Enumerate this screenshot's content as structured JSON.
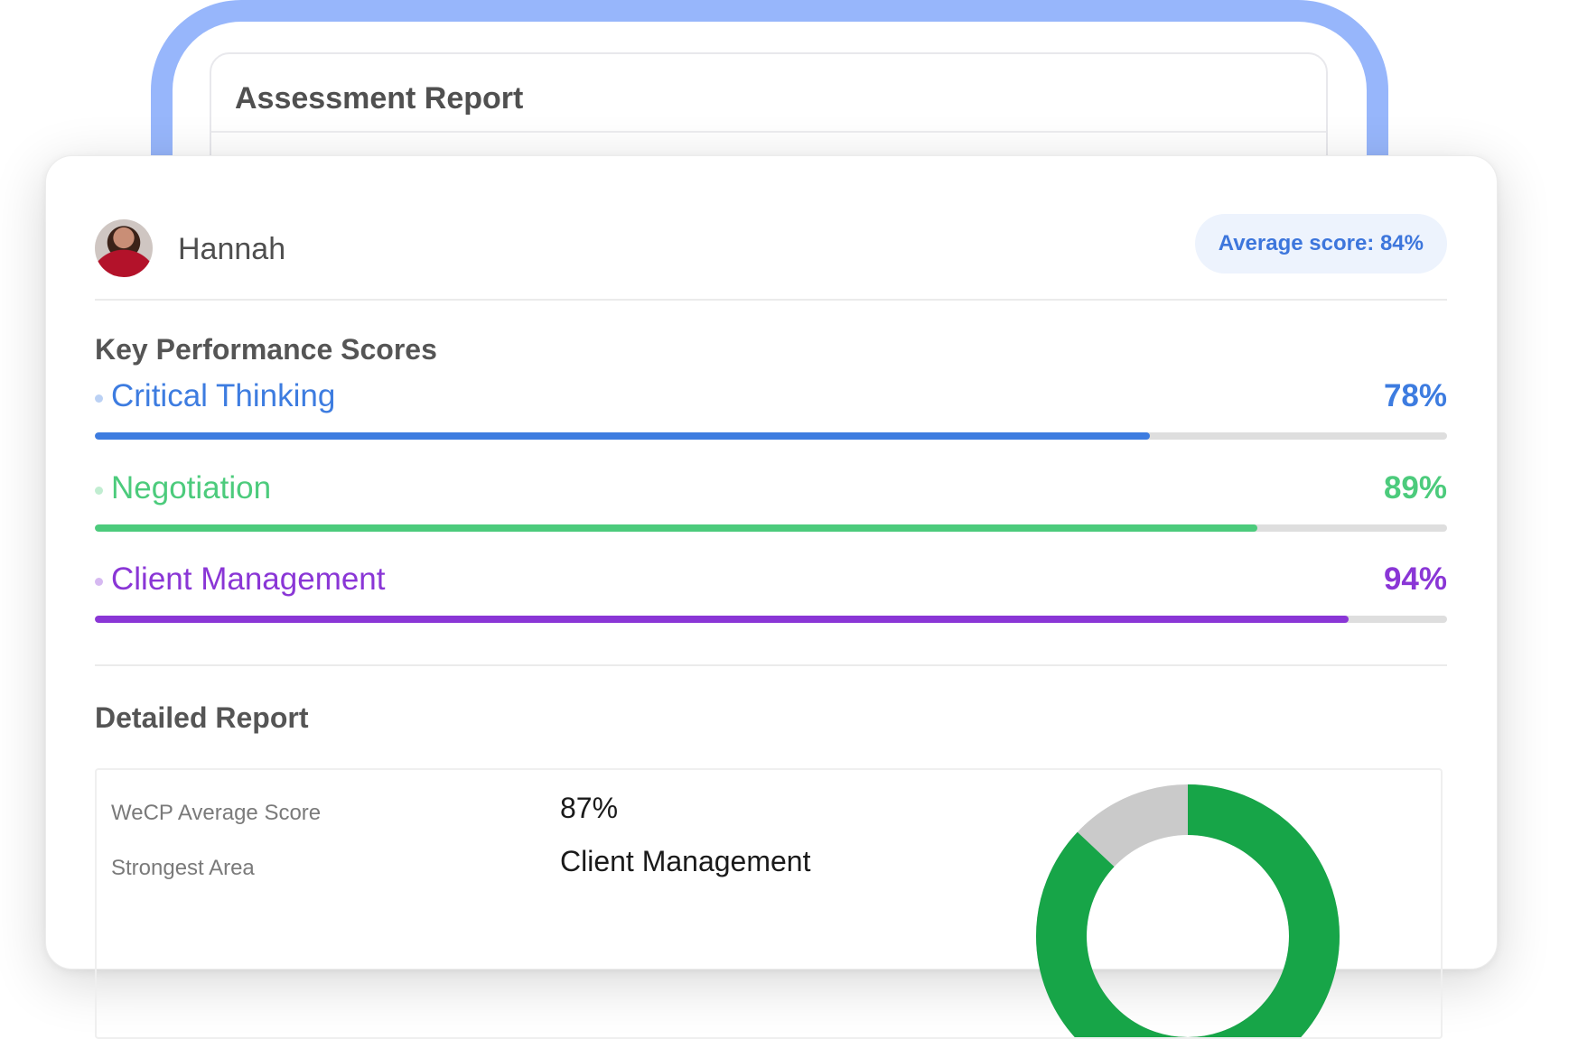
{
  "back_panel": {
    "title": "Assessment Report"
  },
  "candidate": {
    "name": "Hannah",
    "average_score_label": "Average score: 84%"
  },
  "key_scores": {
    "title": "Key Performance Scores",
    "items": [
      {
        "label": "Critical Thinking",
        "value_text": "78%",
        "fraction": 0.78,
        "color": "#3d7ce0"
      },
      {
        "label": "Negotiation",
        "value_text": "89%",
        "fraction": 0.86,
        "color": "#4ccb7c"
      },
      {
        "label": "Client Management",
        "value_text": "94%",
        "fraction": 0.927,
        "color": "#8a36d6"
      }
    ],
    "track_color": "#dedede"
  },
  "detailed_report": {
    "title": "Detailed Report",
    "rows": [
      {
        "label": "WeCP Average Score",
        "value": "87%"
      },
      {
        "label": "Strongest Area",
        "value": "Client Management"
      }
    ],
    "donut": {
      "fraction": 0.87,
      "color": "#17a548",
      "rest_color": "#cacaca"
    }
  }
}
